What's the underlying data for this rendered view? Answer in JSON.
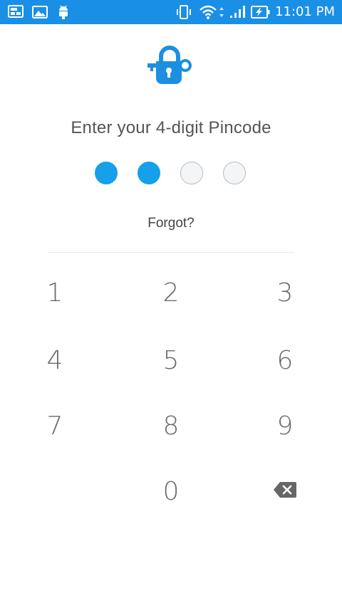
{
  "status_bar": {
    "time": "11:01 PM",
    "icons": [
      "screenshot-notification-icon",
      "gallery-notification-icon",
      "android-debug-icon",
      "vibrate-icon",
      "wifi-icon",
      "data-arrows-icon",
      "cell-signal-icon",
      "battery-charging-icon"
    ]
  },
  "lock": {
    "icon": "lock-with-key-icon",
    "color": "#1d8fe0"
  },
  "prompt": "Enter your 4-digit Pincode",
  "pin": {
    "length": 4,
    "entered": 2,
    "filled_color": "#15a0ea"
  },
  "forgot_label": "Forgot?",
  "keypad": {
    "keys": [
      "1",
      "2",
      "3",
      "4",
      "5",
      "6",
      "7",
      "8",
      "9",
      "0"
    ],
    "backspace_icon": "backspace-icon"
  },
  "colors": {
    "status_bar": "#1a8fe6",
    "accent": "#15a0ea"
  }
}
